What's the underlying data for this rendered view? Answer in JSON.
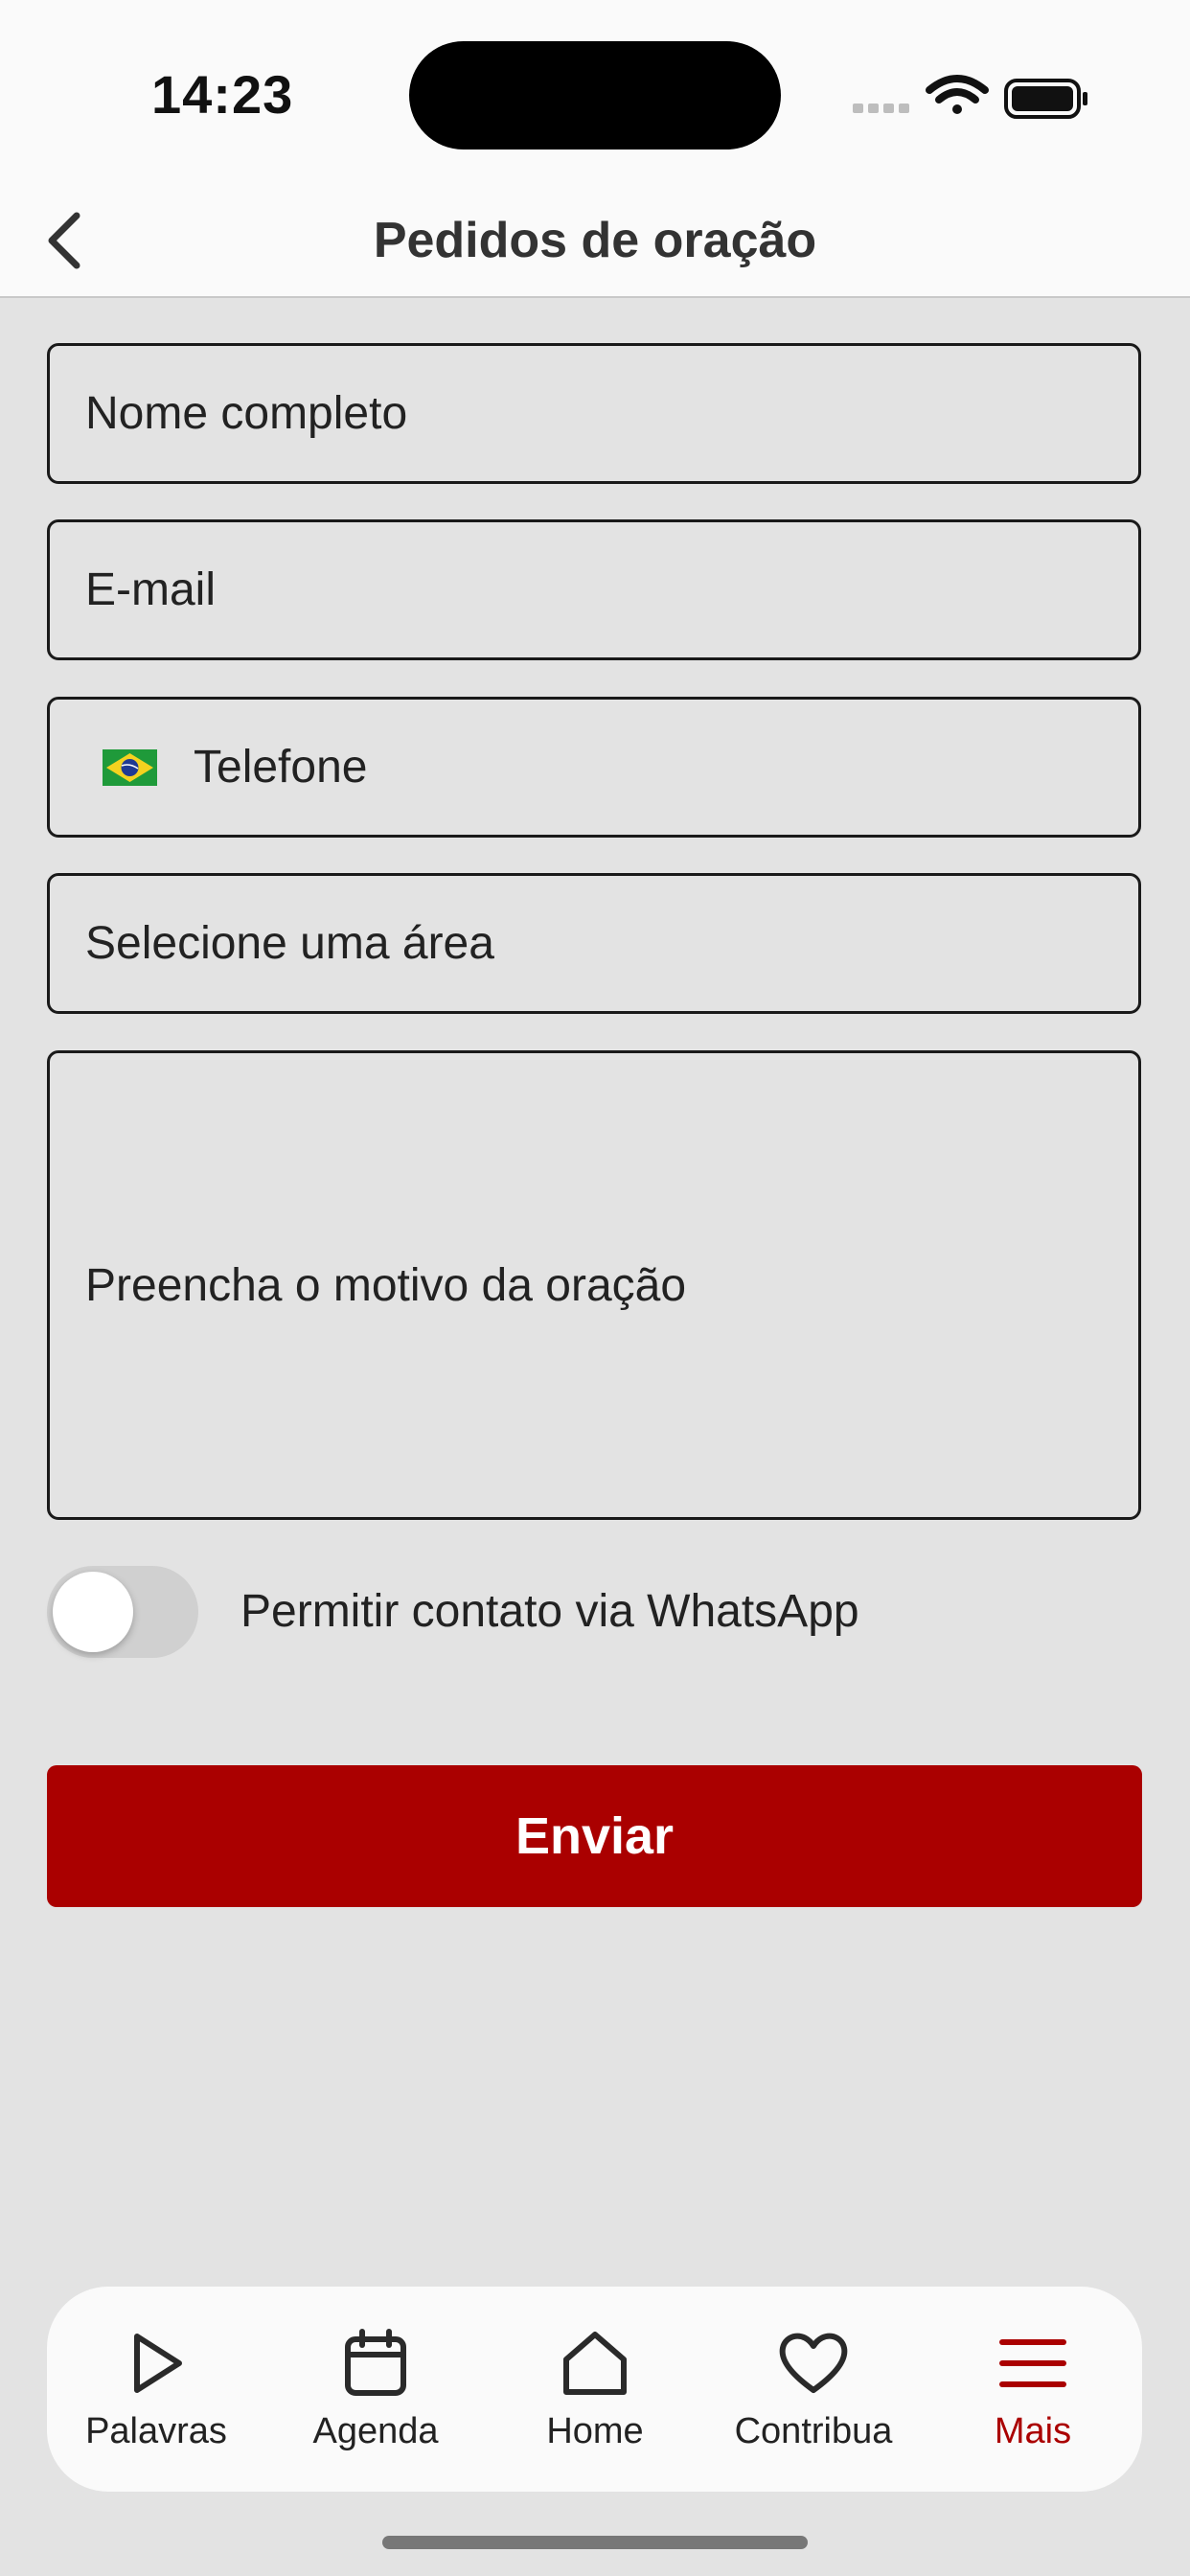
{
  "status_bar": {
    "time": "14:23"
  },
  "header": {
    "title": "Pedidos de oração"
  },
  "form": {
    "name_placeholder": "Nome completo",
    "email_placeholder": "E-mail",
    "phone_placeholder": "Telefone",
    "phone_country_icon": "brazil-flag-icon",
    "area_placeholder": "Selecione uma área",
    "reason_placeholder": "Preencha o motivo da oração",
    "whatsapp_label": "Permitir contato via WhatsApp",
    "whatsapp_enabled": false,
    "submit_label": "Enviar"
  },
  "tabbar": {
    "active": "Mais",
    "items": [
      {
        "label": "Palavras",
        "icon": "play-icon"
      },
      {
        "label": "Agenda",
        "icon": "calendar-icon"
      },
      {
        "label": "Home",
        "icon": "home-icon"
      },
      {
        "label": "Contribua",
        "icon": "heart-icon"
      },
      {
        "label": "Mais",
        "icon": "menu-icon"
      }
    ]
  },
  "colors": {
    "accent": "#aa0000",
    "background": "#e3e3e3",
    "surface": "#fafafa"
  }
}
